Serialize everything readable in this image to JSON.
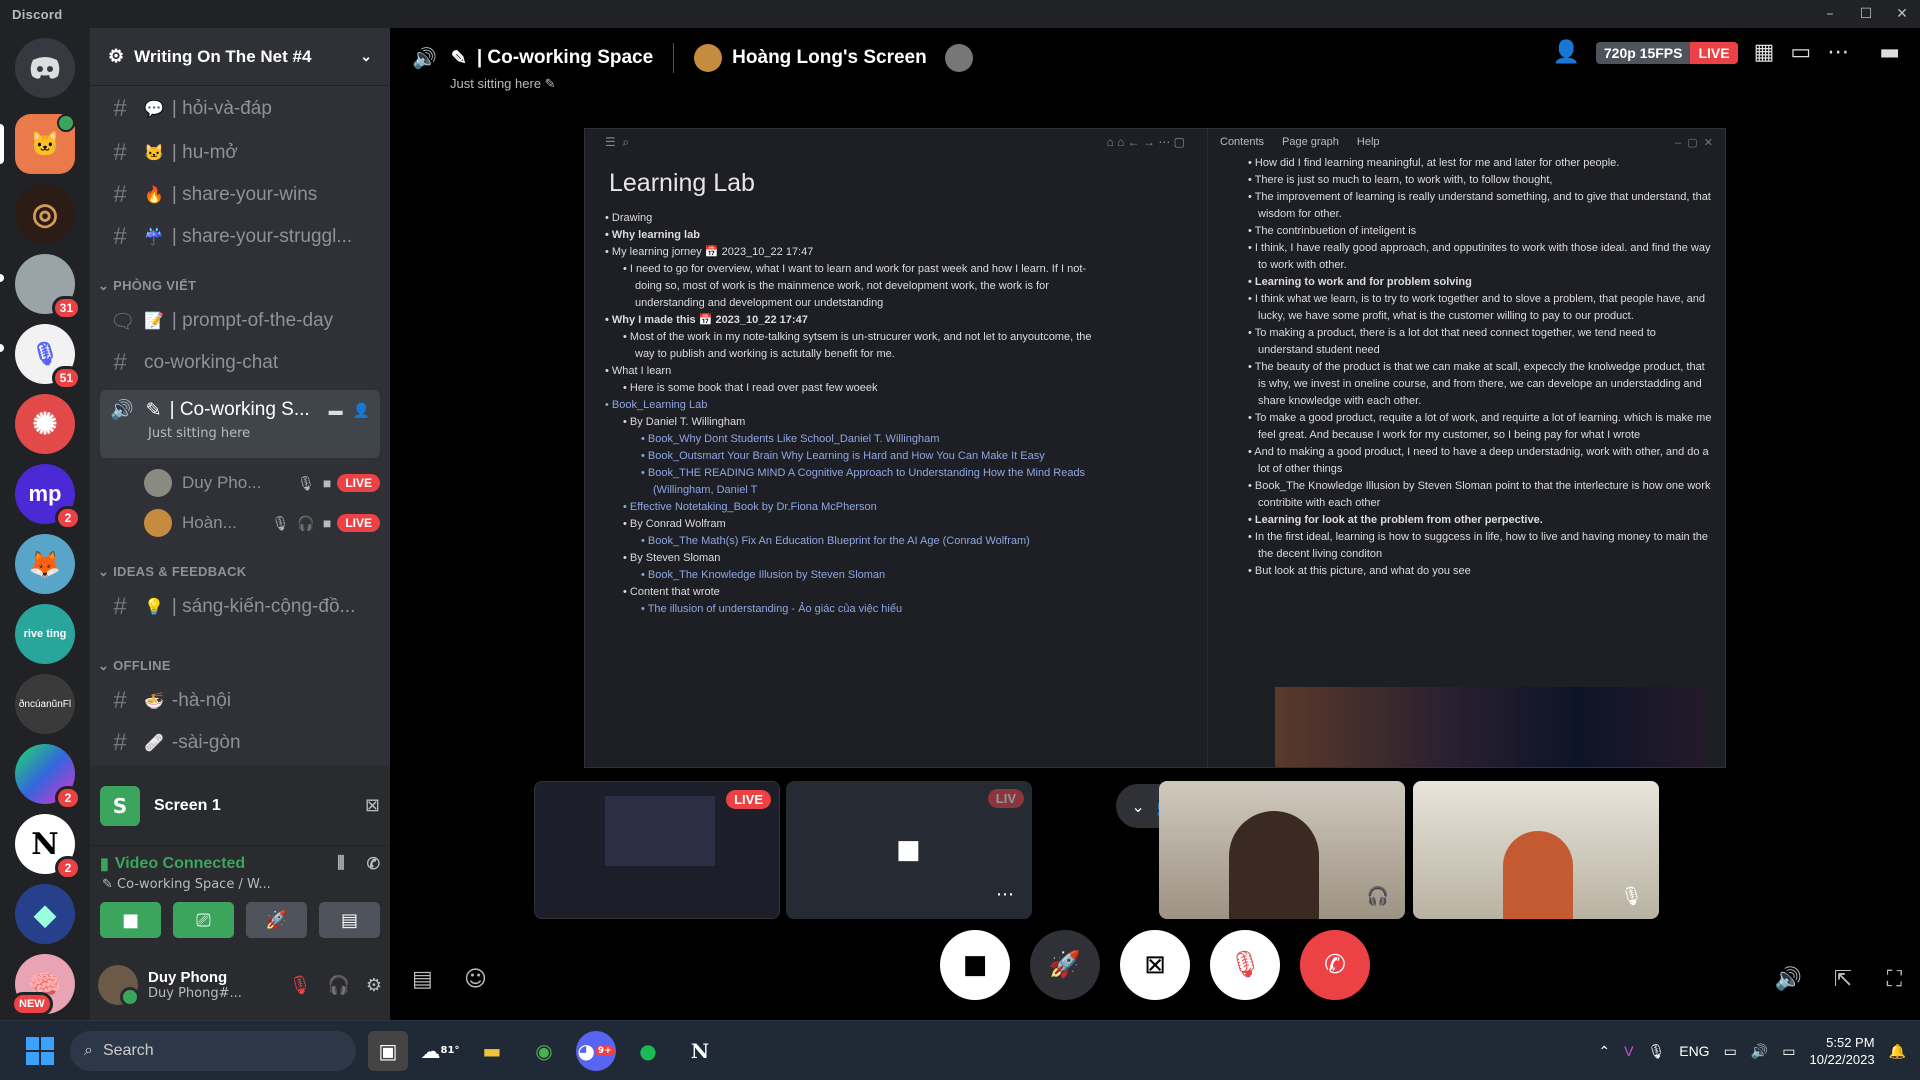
{
  "app": {
    "title": "Discord"
  },
  "servers": [
    {
      "badge": ""
    },
    {
      "badge": ""
    },
    {
      "badge": "31"
    },
    {
      "badge": "51"
    },
    {
      "badge": ""
    },
    {
      "label": "mp",
      "badge": "2"
    },
    {
      "badge": ""
    },
    {
      "label": "rive ting",
      "badge": ""
    },
    {
      "label": "ðncúanũnFl",
      "badge": ""
    },
    {
      "badge": "2"
    },
    {
      "badge": "2"
    },
    {
      "badge": ""
    },
    {
      "badge": "NEW"
    }
  ],
  "sidebar": {
    "guild_name": "Writing On The Net #4",
    "channels_top": [
      {
        "emoji": "💬",
        "name": "hỏi-và-đáp"
      },
      {
        "emoji": "🐱",
        "name": "hu-mở"
      },
      {
        "emoji": "🔥",
        "name": "share-your-wins"
      },
      {
        "emoji": "☔",
        "name": "share-your-struggl..."
      }
    ],
    "cat_phong_viet": "PHÒNG VIẾT",
    "phong_viet": [
      {
        "emoji": "📝",
        "name": "prompt-of-the-day"
      },
      {
        "emoji": "",
        "name": "co-working-chat"
      }
    ],
    "active_voice": {
      "name": "Co-working S...",
      "status": "Just sitting here"
    },
    "members": [
      {
        "name": "Duy Pho...",
        "badge": "LIVE"
      },
      {
        "name": "Hoàn...",
        "badge": "LIVE"
      }
    ],
    "cat_ideas": "IDEAS & FEEDBACK",
    "ideas": [
      {
        "emoji": "💡",
        "name": "sáng-kiến-cộng-đồ..."
      }
    ],
    "cat_offline": "OFFLINE",
    "offline": [
      {
        "emoji": "🍜",
        "name": "-hà-nội"
      },
      {
        "emoji": "🩹",
        "name": "-sài-gòn"
      }
    ]
  },
  "screen_panel": {
    "label": "Screen 1"
  },
  "voice_panel": {
    "status": "Video Connected",
    "location": "Co-working Space / W..."
  },
  "user_panel": {
    "name": "Duy Phong",
    "username": "Duy Phong#..."
  },
  "stage": {
    "channel": "| Co-working Space",
    "streamer": "Hoàng Long's Screen",
    "status": "Just sitting here",
    "quality": "720p 15FPS",
    "live": "LIVE",
    "thumb_live": "LIVE",
    "thumb_live2": "LIV"
  },
  "shared": {
    "tabs": [
      "Contents",
      "Page graph",
      "Help"
    ],
    "title": "Learning Lab",
    "left": [
      {
        "t": "Drawing",
        "lvl": 0
      },
      {
        "t": "Why learning lab",
        "lvl": 0,
        "b": true
      },
      {
        "t": "My learning jorney  📅 2023_10_22   17:47",
        "lvl": 0
      },
      {
        "t": "I need to go for overview, what I want to learn and work for past week and how I learn. If I not-",
        "lvl": 1
      },
      {
        "t": "doing so, most of work is the mainmence work, not development work, the work is for",
        "lvl": 1,
        "c": true
      },
      {
        "t": "understanding and development our undetstanding",
        "lvl": 1,
        "c": true
      },
      {
        "t": "Why I made this  📅 2023_10_22   17:47",
        "lvl": 0,
        "b": true
      },
      {
        "t": "Most of the work in my note-talking sytsem is un-strucurer work, and not let to anyoutcome, the",
        "lvl": 1
      },
      {
        "t": "way to publish and working is actutally benefit for me.",
        "lvl": 1,
        "c": true
      },
      {
        "t": "What I learn",
        "lvl": 0
      },
      {
        "t": "Here is some book that I read over past few woeek",
        "lvl": 1
      },
      {
        "t": "Book_Learning Lab",
        "lvl": 0,
        "lk": true
      },
      {
        "t": "By  Daniel T. Willingham",
        "lvl": 1
      },
      {
        "t": "Book_Why Dont Students Like School_Daniel T. Willingham",
        "lvl": 2,
        "lk": true
      },
      {
        "t": "Book_Outsmart Your Brain Why Learning is Hard and How You Can Make It Easy",
        "lvl": 2,
        "lk": true
      },
      {
        "t": "Book_THE READING MIND A Cognitive Approach to Understanding How the Mind Reads",
        "lvl": 2,
        "lk": true
      },
      {
        "t": "(Willingham, Daniel T",
        "lvl": 2,
        "lk": true,
        "c": true
      },
      {
        "t": "Effective Notetaking_Book by Dr.Fiona McPherson",
        "lvl": 1,
        "lk": true
      },
      {
        "t": "By  Conrad Wolfram",
        "lvl": 1
      },
      {
        "t": "Book_The Math(s) Fix An Education Blueprint for the AI Age (Conrad Wolfram)",
        "lvl": 2,
        "lk": true
      },
      {
        "t": "By  Steven Sloman",
        "lvl": 1
      },
      {
        "t": "Book_The Knowledge Illusion by Steven Sloman",
        "lvl": 2,
        "lk": true
      },
      {
        "t": "",
        "lvl": 1
      },
      {
        "t": "Content that wrote",
        "lvl": 1
      },
      {
        "t": "The illusion of understanding - Ảo giác của việc hiểu",
        "lvl": 2,
        "lk": true
      }
    ],
    "right": [
      "How did I find learning meaningful, at lest for me and later for other people.",
      "There is just so much to learn, to work with, to follow thought,",
      "The improvement of learning is really understand something, and to give that understand, that wisdom for other.",
      "The contrinbuetion of inteligent is",
      "I think, I have really good approach, and opputinites to work with those ideal. and find the way to work with other.",
      "Learning to work and for problem solving",
      "I think what we learn, is to try to work together and to slove a problem, that people have, and lucky, we have some profit, what is the customer willing to pay to our product.",
      "To making a product, there is a lot dot that need connect together, we tend need to understand student need",
      "The beauty of the product is that we can make at scall, expeccly the knolwedge product, that is why, we invest in oneline course, and from there, we can develope an understadding and share knowledge with each other.",
      "To make a good product, requite a lot of work, and requirte a lot of learning. which is make me feel great. And because I work for my customer, so I being pay for what I wrote",
      "And to making a good product, I need to have a deep understadnig, work with other, and do a lot of other things",
      "Book_The Knowledge Illusion by Steven Sloman  point to that the interlecture is how one work contribite with each other",
      "Learning for look at the problem from other perpective.",
      "In the first ideal, learning is how to suggcess in life, how to live and having money to main the the decent living conditon",
      "But look at this picture, and what do you see"
    ]
  },
  "taskbar": {
    "search": "Search",
    "weather": "81°",
    "discord_badge": "9+",
    "lang": "ENG",
    "time": "5:52 PM",
    "date": "10/22/2023"
  },
  "colors": {
    "accent_green": "#3ba55d",
    "live_red": "#ed4245",
    "blurple": "#5865f2"
  }
}
